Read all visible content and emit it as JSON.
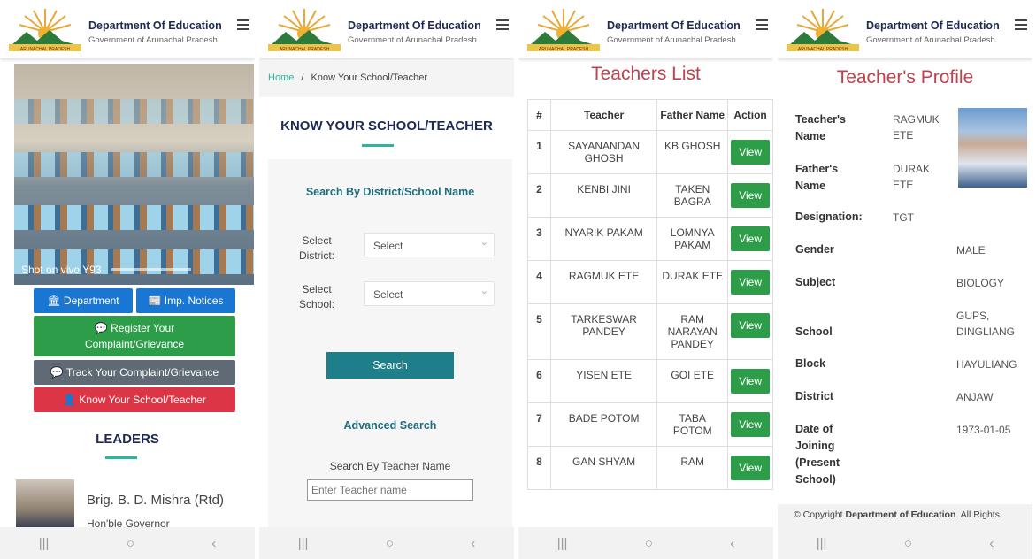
{
  "header": {
    "title": "Department Of Education",
    "subtitle": "Government of Arunachal Pradesh",
    "logo_text": "ARUNACHAL PRADESH"
  },
  "nav": {
    "recent": "|||",
    "home": "○",
    "back": "‹"
  },
  "screen1": {
    "photo_caption": "Shot on vivo Y93",
    "buttons": {
      "department": "🏛 Department",
      "notices": "📰 Imp. Notices",
      "register": "💬 Register Your Complaint/Grievance",
      "track": "💬 Track Your Complaint/Grievance",
      "know": "👤 Know Your School/Teacher"
    },
    "leaders_heading": "LEADERS",
    "leader_name": "Brig. B. D. Mishra (Rtd)",
    "leader_role": "Hon'ble Governor"
  },
  "screen2": {
    "breadcrumb_home": "Home",
    "breadcrumb_sep": "/",
    "breadcrumb_current": "Know Your School/Teacher",
    "title": "KNOW YOUR SCHOOL/TEACHER",
    "search_heading": "Search By District/School Name",
    "district_label": "Select District:",
    "school_label": "Select School:",
    "district_value": "Select",
    "school_value": "Select",
    "search_button": "Search",
    "advanced_heading": "Advanced Search",
    "teacher_name_label": "Search By Teacher Name",
    "teacher_name_placeholder": "Enter Teacher name"
  },
  "screen3": {
    "title": "Teachers List",
    "columns": [
      "#",
      "Teacher",
      "Father Name",
      "Action"
    ],
    "view_label": "View",
    "rows": [
      {
        "n": "1",
        "teacher": "SAYANANDAN GHOSH",
        "father": "KB GHOSH"
      },
      {
        "n": "2",
        "teacher": "KENBI JINI",
        "father": "TAKEN BAGRA"
      },
      {
        "n": "3",
        "teacher": "NYARIK PAKAM",
        "father": "LOMNYA PAKAM"
      },
      {
        "n": "4",
        "teacher": "RAGMUK ETE",
        "father": "DURAK ETE"
      },
      {
        "n": "5",
        "teacher": "TARKESWAR PANDEY",
        "father": "RAM NARAYAN PANDEY"
      },
      {
        "n": "6",
        "teacher": "YISEN ETE",
        "father": "GOI ETE"
      },
      {
        "n": "7",
        "teacher": "BADE POTOM",
        "father": "TABA POTOM"
      },
      {
        "n": "8",
        "teacher": "GAN SHYAM",
        "father": "RAM"
      }
    ]
  },
  "screen4": {
    "title": "Teacher's Profile",
    "fields": {
      "name_label": "Teacher's Name",
      "name_value": "RAGMUK ETE",
      "father_label": "Father's Name",
      "father_value": "DURAK ETE",
      "designation_label": "Designation:",
      "designation_value": "TGT",
      "gender_label": "Gender",
      "gender_value": "MALE",
      "subject_label": "Subject",
      "subject_value": "BIOLOGY",
      "school_label": "School",
      "school_value": "GUPS, DINGLIANG",
      "block_label": "Block",
      "block_value": "HAYULIANG",
      "district_label": "District",
      "district_value": "ANJAW",
      "doj_label": "Date of Joining (Present School)",
      "doj_value": "1973-01-05"
    },
    "copyright_prefix": "© Copyright ",
    "copyright_org": "Department of Education",
    "copyright_suffix": ". All Rights"
  }
}
